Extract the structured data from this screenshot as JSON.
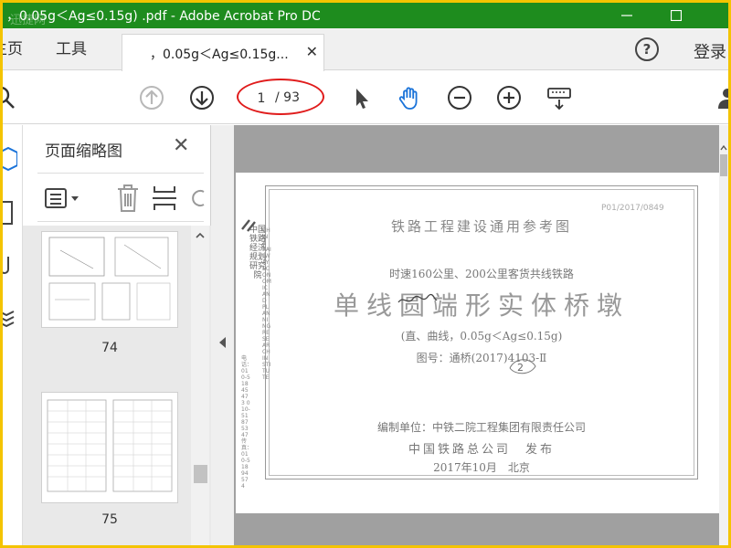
{
  "window": {
    "title": "，0.05g＜Ag≤0.15g) .pdf - Adobe Acrobat Pro DC",
    "watermark": "迅捷网"
  },
  "tabs": {
    "home": "主页",
    "tools": "工具",
    "document": "，0.05g＜Ag≤0.15g...",
    "help": "?",
    "login": "登录"
  },
  "toolbar": {
    "current_page": "1",
    "total_pages": "/ 93"
  },
  "thumbnails": {
    "title": "页面缩略图",
    "items": [
      {
        "page": "74"
      },
      {
        "page": "75"
      }
    ]
  },
  "document": {
    "org_vertical": "中国铁路经济规划研究院",
    "org_vertical_en": "CHINA RAILWAY ECONOMIC AND PLANNING RESEARCH INSTITUTE",
    "contact_vertical": "电话：010-51845473 010-51875347 传真：010-51894574",
    "stamp": "P01/2017/0849",
    "heading": "铁路工程建设通用参考图",
    "subheading": "时速160公里、200公里客货共线铁路",
    "main_title": "单线圆端形实体桥墩",
    "params": "(直、曲线，0.05g＜Ag≤0.15g)",
    "drawing_no": "图号：通桥(2017)4103-Ⅱ",
    "compiler": "编制单位：中铁二院工程集团有限责任公司",
    "publisher": "中国铁路总公司　发布",
    "date": "2017年10月　北京"
  },
  "colors": {
    "titlebar": "#1e8c1e",
    "frame": "#f4c400",
    "annotation": "#e01b1b",
    "accent": "#1a73d9"
  }
}
